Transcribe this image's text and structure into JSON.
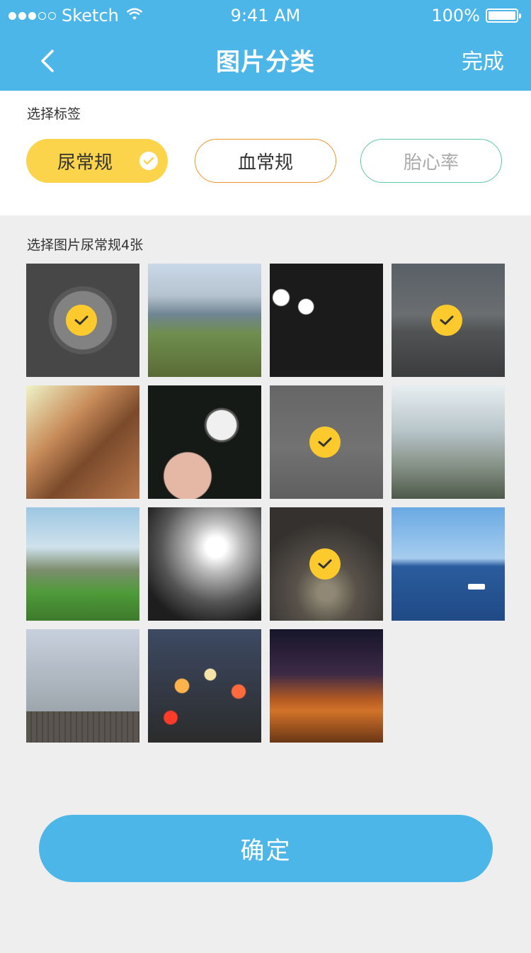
{
  "status_bar": {
    "carrier": "Sketch",
    "time": "9:41 AM",
    "battery": "100%"
  },
  "nav": {
    "title": "图片分类",
    "done_label": "完成",
    "back_icon": "chevron-left-icon"
  },
  "tags_section": {
    "label": "选择标签",
    "tags": [
      {
        "label": "尿常规",
        "selected": true,
        "color": "#fcd44b"
      },
      {
        "label": "血常规",
        "selected": false,
        "color": "#f0932b"
      },
      {
        "label": "胎心率",
        "selected": false,
        "color": "#5cc8a8"
      }
    ]
  },
  "photos_section": {
    "label": "选择图片尿常规4张",
    "photos": [
      {
        "subject": "clock",
        "selected": true
      },
      {
        "subject": "mountains",
        "selected": false
      },
      {
        "subject": "night-lamps",
        "selected": false
      },
      {
        "subject": "road-wind-turbines",
        "selected": true
      },
      {
        "subject": "bridge-arches",
        "selected": false
      },
      {
        "subject": "dandelion",
        "selected": false
      },
      {
        "subject": "foggy-beach",
        "selected": true
      },
      {
        "subject": "rainy-window-city",
        "selected": false
      },
      {
        "subject": "stones-on-grass",
        "selected": false
      },
      {
        "subject": "sun-behind-clouds",
        "selected": false
      },
      {
        "subject": "cave-silhouettes",
        "selected": true
      },
      {
        "subject": "ocean-boat",
        "selected": false
      },
      {
        "subject": "foggy-pier",
        "selected": false
      },
      {
        "subject": "city-bokeh",
        "selected": false
      },
      {
        "subject": "desert-dusk",
        "selected": false
      }
    ]
  },
  "confirm_label": "确定",
  "colors": {
    "primary": "#4db6e8",
    "check_yellow": "#fcca2c",
    "background": "#eeeeee"
  }
}
